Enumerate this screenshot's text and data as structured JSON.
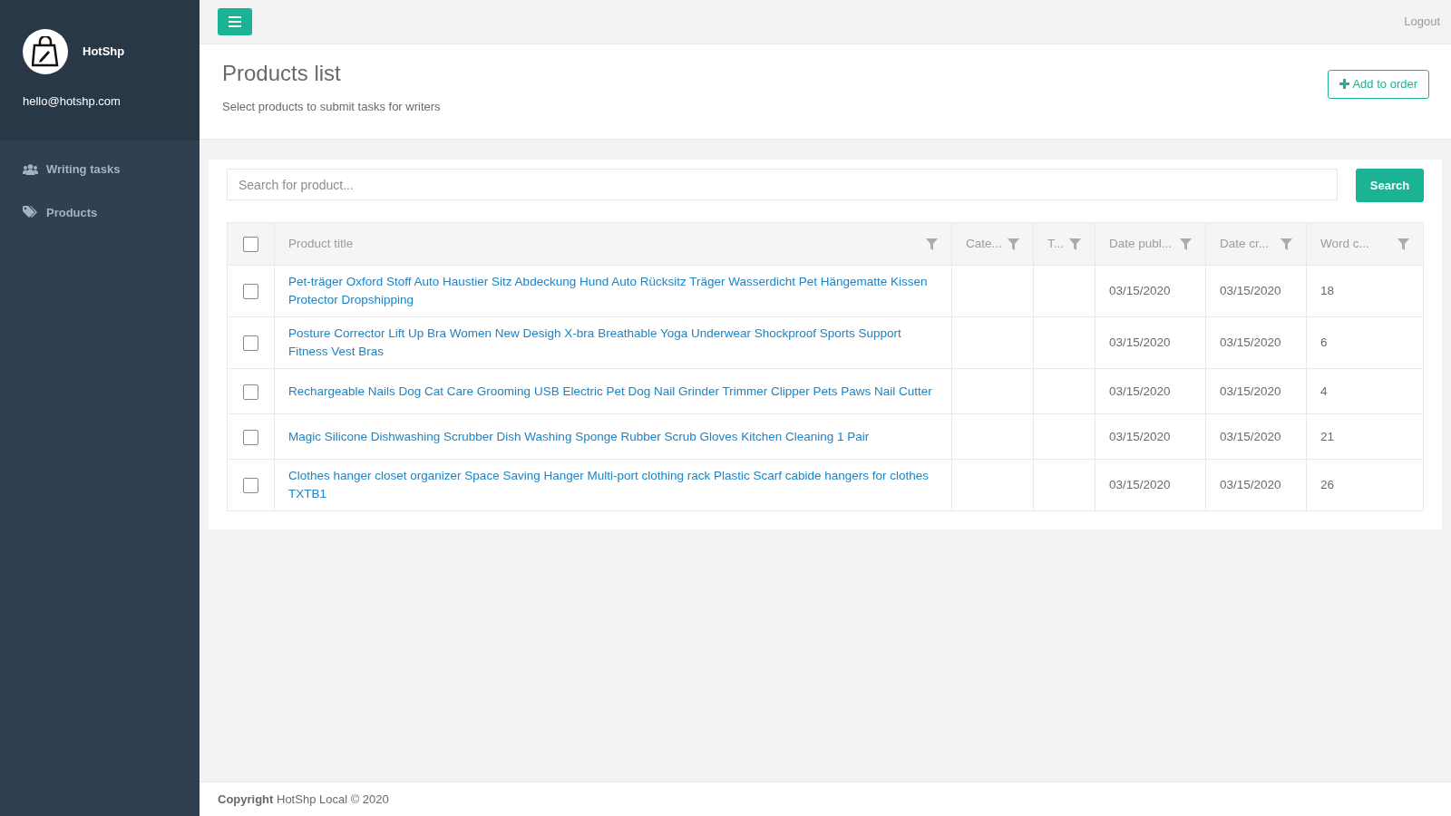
{
  "sidebar": {
    "brand": "HotShp",
    "email": "hello@hotshp.com",
    "items": [
      {
        "label": "Writing tasks",
        "selected": false
      },
      {
        "label": "Products",
        "selected": false
      }
    ]
  },
  "topbar": {
    "logout": "Logout"
  },
  "header": {
    "title": "Products list",
    "subtitle": "Select products to submit tasks for writers",
    "add_button": "Add to order"
  },
  "search": {
    "placeholder": "Search for product...",
    "button": "Search"
  },
  "table": {
    "select_all_checked": false,
    "columns": [
      "Product title",
      "Cate...",
      "T...",
      "Date publ...",
      "Date cr...",
      "Word c..."
    ],
    "rows": [
      {
        "checked": false,
        "title": "Pet-träger Oxford Stoff Auto Haustier Sitz Abdeckung Hund Auto Rücksitz Träger Wasserdicht Pet Hängematte Kissen Protector Dropshipping",
        "date_published": "03/15/2020",
        "date_created": "03/15/2020",
        "word_count": "18"
      },
      {
        "checked": false,
        "title": "Posture Corrector Lift Up Bra Women New Desigh X-bra Breathable Yoga Underwear Shockproof Sports Support Fitness Vest Bras",
        "date_published": "03/15/2020",
        "date_created": "03/15/2020",
        "word_count": "6"
      },
      {
        "checked": false,
        "title": "Rechargeable Nails Dog Cat Care Grooming USB Electric Pet Dog Nail Grinder Trimmer Clipper Pets Paws Nail Cutter",
        "date_published": "03/15/2020",
        "date_created": "03/15/2020",
        "word_count": "4"
      },
      {
        "checked": false,
        "title": "Magic Silicone Dishwashing Scrubber Dish Washing Sponge Rubber Scrub Gloves Kitchen Cleaning 1 Pair",
        "date_published": "03/15/2020",
        "date_created": "03/15/2020",
        "word_count": "21"
      },
      {
        "checked": false,
        "title": "Clothes hanger closet organizer Space Saving Hanger Multi-port clothing rack Plastic Scarf cabide hangers for clothes TXTB1",
        "date_published": "03/15/2020",
        "date_created": "03/15/2020",
        "word_count": "26"
      }
    ]
  },
  "footer": {
    "text": "**Copyright** HotShp Local © 2020"
  }
}
